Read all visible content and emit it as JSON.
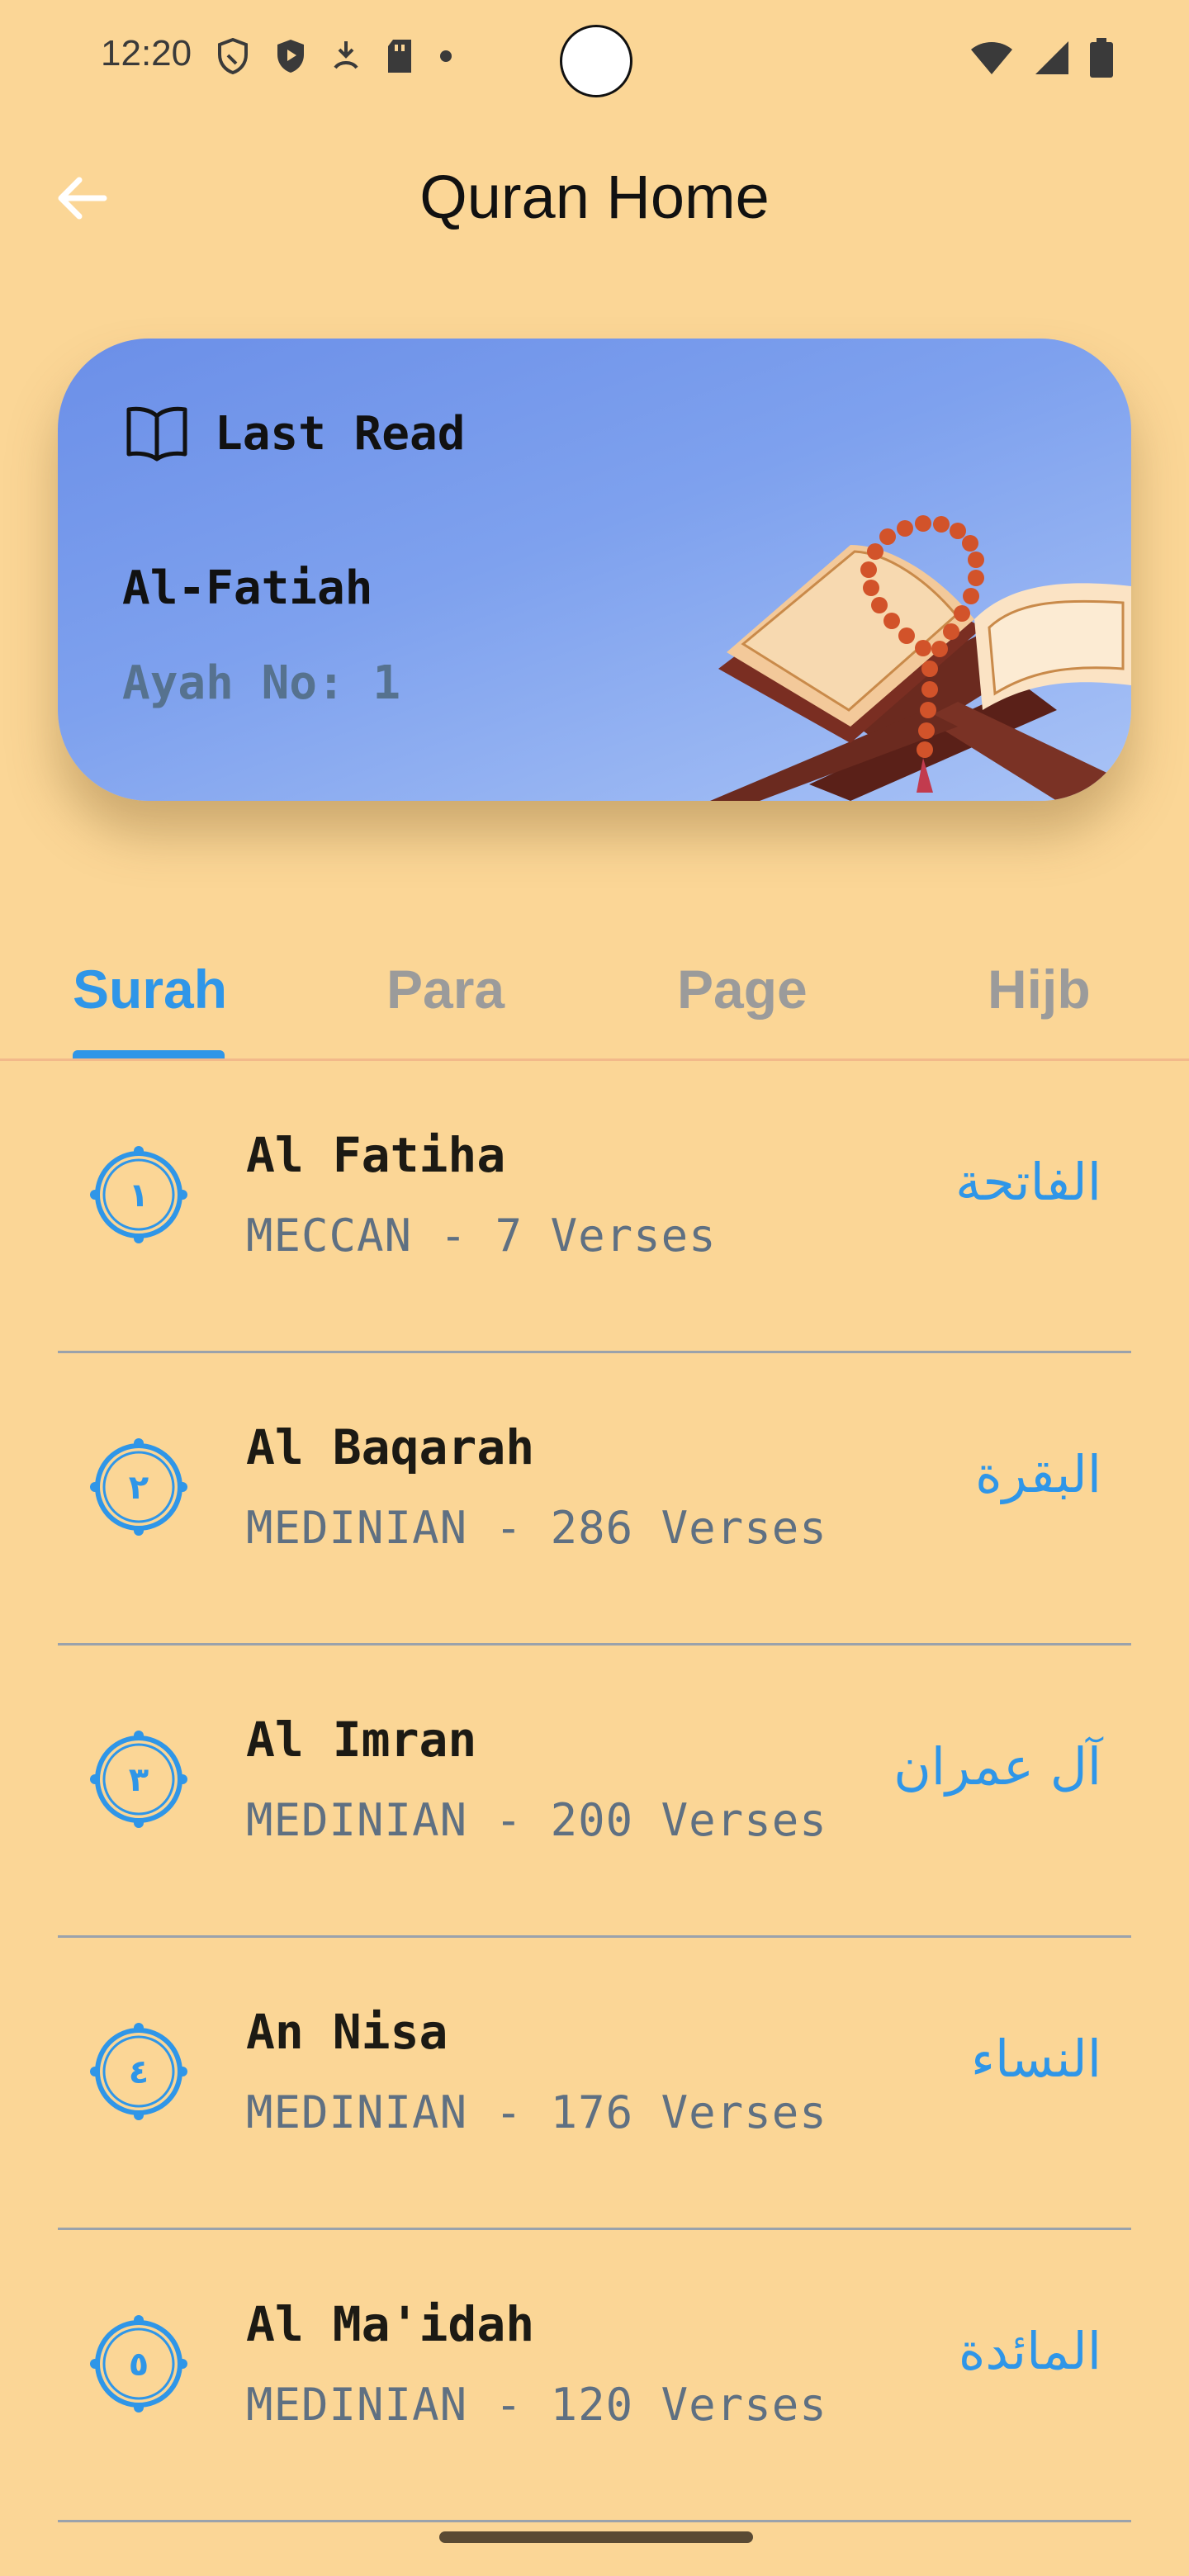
{
  "status_bar": {
    "time": "12:20",
    "icons_left": [
      "shield-icon",
      "play-shield-icon",
      "download-icon",
      "sd-card-icon",
      "dot-icon"
    ],
    "icons_right": [
      "wifi-icon",
      "signal-icon",
      "battery-icon"
    ]
  },
  "app_bar": {
    "title": "Quran Home",
    "back_icon": "arrow-left-icon"
  },
  "last_read": {
    "label": "Last Read",
    "surah": "Al-Fatiah",
    "ayah": "Ayah No: 1"
  },
  "tabs": [
    {
      "label": "Surah",
      "active": true
    },
    {
      "label": "Para",
      "active": false
    },
    {
      "label": "Page",
      "active": false
    },
    {
      "label": "Hijb",
      "active": false
    }
  ],
  "surahs": [
    {
      "number": "١",
      "name": "Al Fatiha",
      "meta": "MECCAN - 7 Verses",
      "arabic": "الفاتحة"
    },
    {
      "number": "٢",
      "name": "Al Baqarah",
      "meta": "MEDINIAN - 286 Verses",
      "arabic": "البقرة"
    },
    {
      "number": "٣",
      "name": "Al Imran",
      "meta": "MEDINIAN - 200 Verses",
      "arabic": "آل عمران"
    },
    {
      "number": "٤",
      "name": "An Nisa",
      "meta": "MEDINIAN - 176 Verses",
      "arabic": "النساء"
    },
    {
      "number": "٥",
      "name": "Al Ma'idah",
      "meta": "MEDINIAN - 120 Verses",
      "arabic": "المائدة"
    }
  ],
  "colors": {
    "background": "#FBD696",
    "accent": "#2F96E8",
    "card_gradient_top": "#6B8FE8",
    "card_gradient_bottom": "#A9C3F6"
  }
}
